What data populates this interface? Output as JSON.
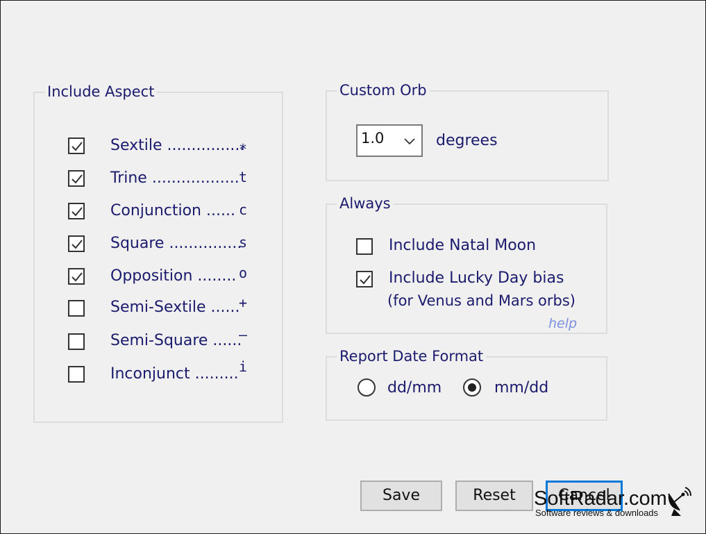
{
  "include_aspect": {
    "title": "Include Aspect",
    "items": [
      {
        "label": "Sextile ................",
        "symbol": "*",
        "checked": true
      },
      {
        "label": "Trine ..................",
        "symbol": "t",
        "checked": true
      },
      {
        "label": "Conjunction ......",
        "symbol": "c",
        "checked": true
      },
      {
        "label": "Square ...............",
        "symbol": "s",
        "checked": true
      },
      {
        "label": "Opposition ........",
        "symbol": "o",
        "checked": true
      },
      {
        "label": "Semi-Sextile ......",
        "symbol": "+",
        "checked": false
      },
      {
        "label": "Semi-Square ......",
        "symbol": "–",
        "checked": false
      },
      {
        "label": "Inconjunct .........",
        "symbol": "i",
        "checked": false
      }
    ]
  },
  "custom_orb": {
    "title": "Custom Orb",
    "value": "1.0",
    "unit": "degrees"
  },
  "always": {
    "title": "Always",
    "natal_moon": {
      "label": "Include Natal Moon",
      "checked": false
    },
    "lucky_day": {
      "label": "Include Lucky Day bias",
      "sublabel": "(for Venus and Mars orbs)",
      "checked": true
    },
    "help": "help"
  },
  "report_date_format": {
    "title": "Report Date Format",
    "options": [
      {
        "label": "dd/mm",
        "selected": false
      },
      {
        "label": "mm/dd",
        "selected": true
      }
    ]
  },
  "buttons": {
    "save": "Save",
    "reset": "Reset",
    "cancel": "Cancel"
  },
  "watermark": {
    "brand": "SoftRadar.com",
    "tagline": "Software reviews & downloads"
  }
}
